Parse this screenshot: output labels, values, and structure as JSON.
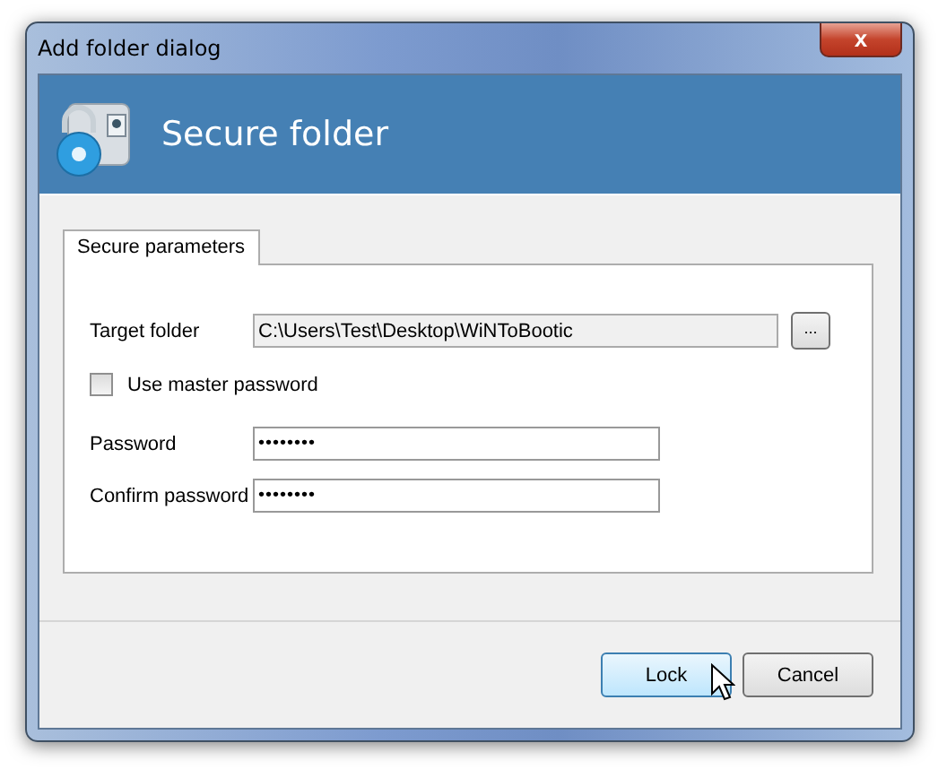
{
  "window": {
    "title": "Add folder dialog",
    "close": "x"
  },
  "header": {
    "title": "Secure folder"
  },
  "tabs": [
    {
      "label": "Secure parameters",
      "selected": true
    }
  ],
  "form": {
    "target_folder": {
      "label": "Target folder",
      "value": "C:\\Users\\Test\\Desktop\\WiNToBootic",
      "browse": "..."
    },
    "master_password": {
      "label": "Use master password",
      "checked": false
    },
    "password": {
      "label": "Password",
      "value": "••••••••"
    },
    "confirm_password": {
      "label": "Confirm password",
      "value": "••••••••"
    }
  },
  "buttons": [
    {
      "label": "Lock",
      "kind": "default"
    },
    {
      "label": "Cancel",
      "kind": "normal"
    }
  ]
}
